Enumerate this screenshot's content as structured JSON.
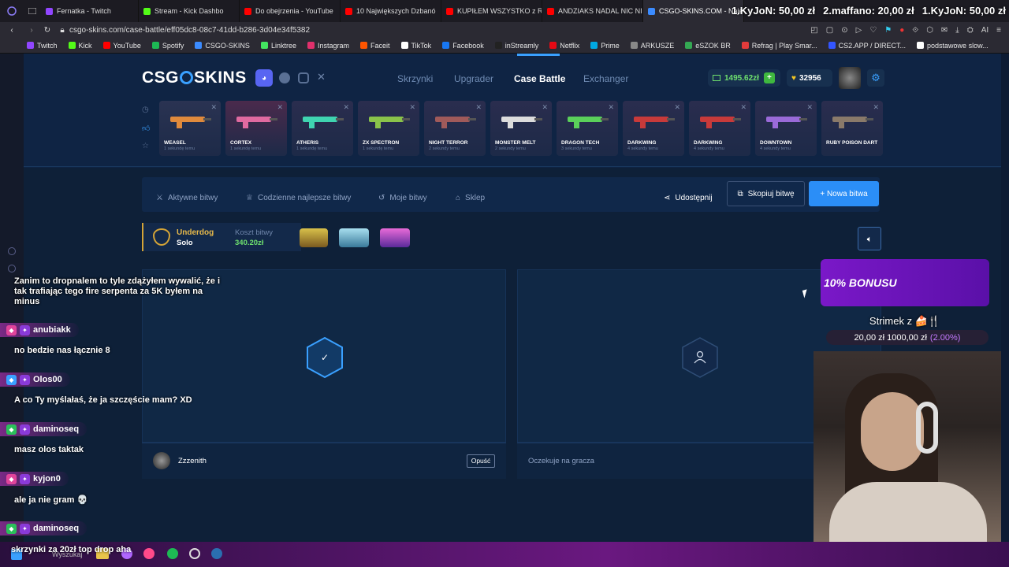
{
  "browser": {
    "tabs": [
      {
        "label": "Fernatka - Twitch",
        "color": "#9146ff"
      },
      {
        "label": "Stream - Kick Dashbo",
        "color": "#53fc18"
      },
      {
        "label": "Do obejrzenia - YouTube",
        "color": "#ff0000"
      },
      {
        "label": "10 Największych Dzbanó",
        "color": "#ff0000"
      },
      {
        "label": "KUPIŁEM WSZYSTKO z R",
        "color": "#ff0000"
      },
      {
        "label": "ANDZIAKS NADAL NIC NI",
        "color": "#ff0000"
      },
      {
        "label": "CSGO-SKINS.COM - Naje",
        "color": "#3b8bff"
      }
    ],
    "url": "csgo-skins.com/case-battle/eff05dc8-08c7-41dd-b286-3d04e34f5382",
    "bookmarks": [
      {
        "label": "Twitch",
        "color": "#9146ff"
      },
      {
        "label": "Kick",
        "color": "#53fc18"
      },
      {
        "label": "YouTube",
        "color": "#ff0000"
      },
      {
        "label": "Spotify",
        "color": "#1db954"
      },
      {
        "label": "CSGO-SKINS",
        "color": "#3b8bff"
      },
      {
        "label": "Linktree",
        "color": "#43e660"
      },
      {
        "label": "Instagram",
        "color": "#e1306c"
      },
      {
        "label": "Faceit",
        "color": "#ff5500"
      },
      {
        "label": "TikTok",
        "color": "#ffffff"
      },
      {
        "label": "Facebook",
        "color": "#1877f2"
      },
      {
        "label": "inStreamly",
        "color": "#222222"
      },
      {
        "label": "Netflix",
        "color": "#e50914"
      },
      {
        "label": "Prime",
        "color": "#00a8e1"
      },
      {
        "label": "ARKUSZE",
        "color": "#888888"
      },
      {
        "label": "eSZOK BR",
        "color": "#34a853"
      },
      {
        "label": "Refrag | Play Smar...",
        "color": "#e23b3b"
      },
      {
        "label": "CS2.APP / DIRECT...",
        "color": "#3355ff"
      },
      {
        "label": "podstawowe slow...",
        "color": "#ffffff"
      }
    ]
  },
  "donations": [
    "1.KyJoN: 50,00 zł",
    "2.maffano: 20,00 zł",
    "1.KyJoN: 50,00 zł"
  ],
  "site": {
    "logo": "CSG",
    "logo2": "SKINS",
    "nav": [
      "Skrzynki",
      "Upgrader",
      "Case Battle",
      "Exchanger"
    ],
    "balance": "1495.62zł",
    "coins": "32956",
    "drops": [
      {
        "name": "WEASEL",
        "sub": "1 sekundę temu",
        "color": "#e08a3c",
        "bg": "#2a3352"
      },
      {
        "name": "CORTEX",
        "sub": "1 sekundę temu",
        "color": "#e06aa0",
        "bg": "#4a2a4c"
      },
      {
        "name": "ATHERIS",
        "sub": "1 sekundę temu",
        "color": "#3fd4b0",
        "bg": "#2a2d4e"
      },
      {
        "name": "ZX SPECTRON",
        "sub": "1 sekundę temu",
        "color": "#8ac34a",
        "bg": "#2a2d4e"
      },
      {
        "name": "NIGHT TERROR",
        "sub": "2 sekundy temu",
        "color": "#a05a5a",
        "bg": "#2a2d4e"
      },
      {
        "name": "MONSTER MELT",
        "sub": "2 sekundy temu",
        "color": "#dcdcdc",
        "bg": "#2a2d4e"
      },
      {
        "name": "DRAGON TECH",
        "sub": "3 sekundy temu",
        "color": "#5ad05a",
        "bg": "#2a2d4e"
      },
      {
        "name": "DARKWING",
        "sub": "4 sekundy temu",
        "color": "#c83a3a",
        "bg": "#2a2d4e"
      },
      {
        "name": "DARKWING",
        "sub": "4 sekundy temu",
        "color": "#c83a3a",
        "bg": "#2a2d4e"
      },
      {
        "name": "DOWNTOWN",
        "sub": "4 sekundy temu",
        "color": "#9a6ad8",
        "bg": "#2a2d4e"
      },
      {
        "name": "RUBY POISON DART",
        "sub": "",
        "color": "#8a7a6a",
        "bg": "#2a2d4e"
      }
    ],
    "subnav": [
      "Aktywne bitwy",
      "Codzienne najlepsze bitwy",
      "Moje bitwy",
      "Sklep"
    ],
    "share": "Udostępnij",
    "copy": "Skopiuj bitwę",
    "new": "+ Nowa bitwa",
    "mode": "Underdog",
    "mode_sub": "Solo",
    "cost_label": "Koszt bitwy",
    "cost": "340.20zł",
    "player1": "Zzzenith",
    "leave": "Opuść",
    "waiting": "Oczekuje na gracza"
  },
  "overlay": {
    "bonus": "10% BONUSU",
    "goal_title": "Strimek z 🍰🍴",
    "goal_value": "20,00 zł  1000,00 zł",
    "goal_pct": "(2.00%)"
  },
  "chat": {
    "first": "Zanim to dropnalem to tyle zdążyłem wywalić, że i tak trafiając tego fire serpenta za 5K byłem na minus",
    "items": [
      {
        "user": "anubiakk",
        "msg": "no bedzie nas łącznie 8"
      },
      {
        "user": "Olos00",
        "msg": "A co Ty myślałaś, że ja szczęście mam? XD"
      },
      {
        "user": "daminoseq",
        "msg": "masz olos taktak"
      },
      {
        "user": "kyjon0",
        "msg": "ale ja nie gram 💀"
      },
      {
        "user": "daminoseq",
        "msg": "skrzynki za 20zł top drop aha"
      }
    ],
    "search": "Wyszukaj"
  }
}
